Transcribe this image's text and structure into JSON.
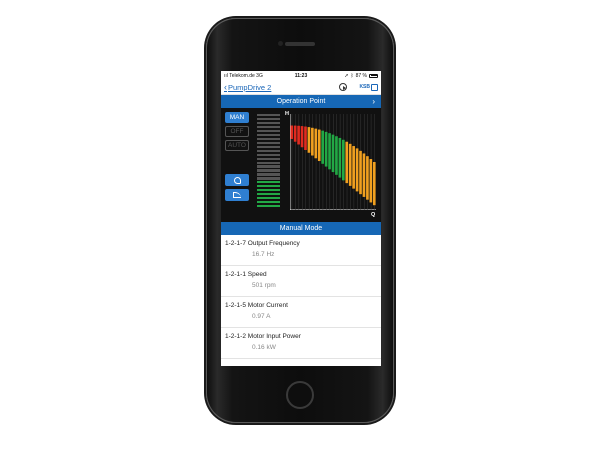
{
  "status_bar": {
    "carrier": "Telekom.de",
    "network": "3G",
    "time": "11:23",
    "battery_text": "87 %",
    "battery_level": 0.87
  },
  "nav": {
    "back_label": "PumpDrive 2",
    "brand": "KSB"
  },
  "operation_point": {
    "title": "Operation Point"
  },
  "modes": {
    "man": "MAN",
    "off": "OFF",
    "auto": "AUTO",
    "active": "MAN"
  },
  "level": {
    "segments": 24,
    "active_segments": 7,
    "active_color": "#22a845",
    "inactive_color": "#555555"
  },
  "chart": {
    "h_label": "H",
    "q_label": "Q",
    "columns": 25,
    "top_start": 0.12,
    "top_end": 0.5,
    "bottom_start": 0.26,
    "bottom_end": 0.95,
    "color_bands": [
      "#e02b20",
      "#e02b20",
      "#e02b20",
      "#e02b20",
      "#e02b20",
      "#f0a020",
      "#f0a020",
      "#f0a020",
      "#f0a020",
      "#22a845",
      "#22a845",
      "#22a845",
      "#22a845",
      "#22a845",
      "#22a845",
      "#22a845",
      "#f0a020",
      "#f0a020",
      "#f0a020",
      "#f0a020",
      "#f0a020",
      "#f0a020",
      "#f0a020",
      "#f0a020",
      "#f0a020"
    ]
  },
  "manual_mode": {
    "title": "Manual Mode"
  },
  "parameters": [
    {
      "code": "1-2-1-7",
      "name": "Output Frequency",
      "value": "16.7 Hz"
    },
    {
      "code": "1-2-1-1",
      "name": "Speed",
      "value": "501 rpm"
    },
    {
      "code": "1-2-1-5",
      "name": "Motor Current",
      "value": "0.97 A"
    },
    {
      "code": "1-2-1-2",
      "name": "Motor Input Power",
      "value": "0.16 kW"
    }
  ]
}
